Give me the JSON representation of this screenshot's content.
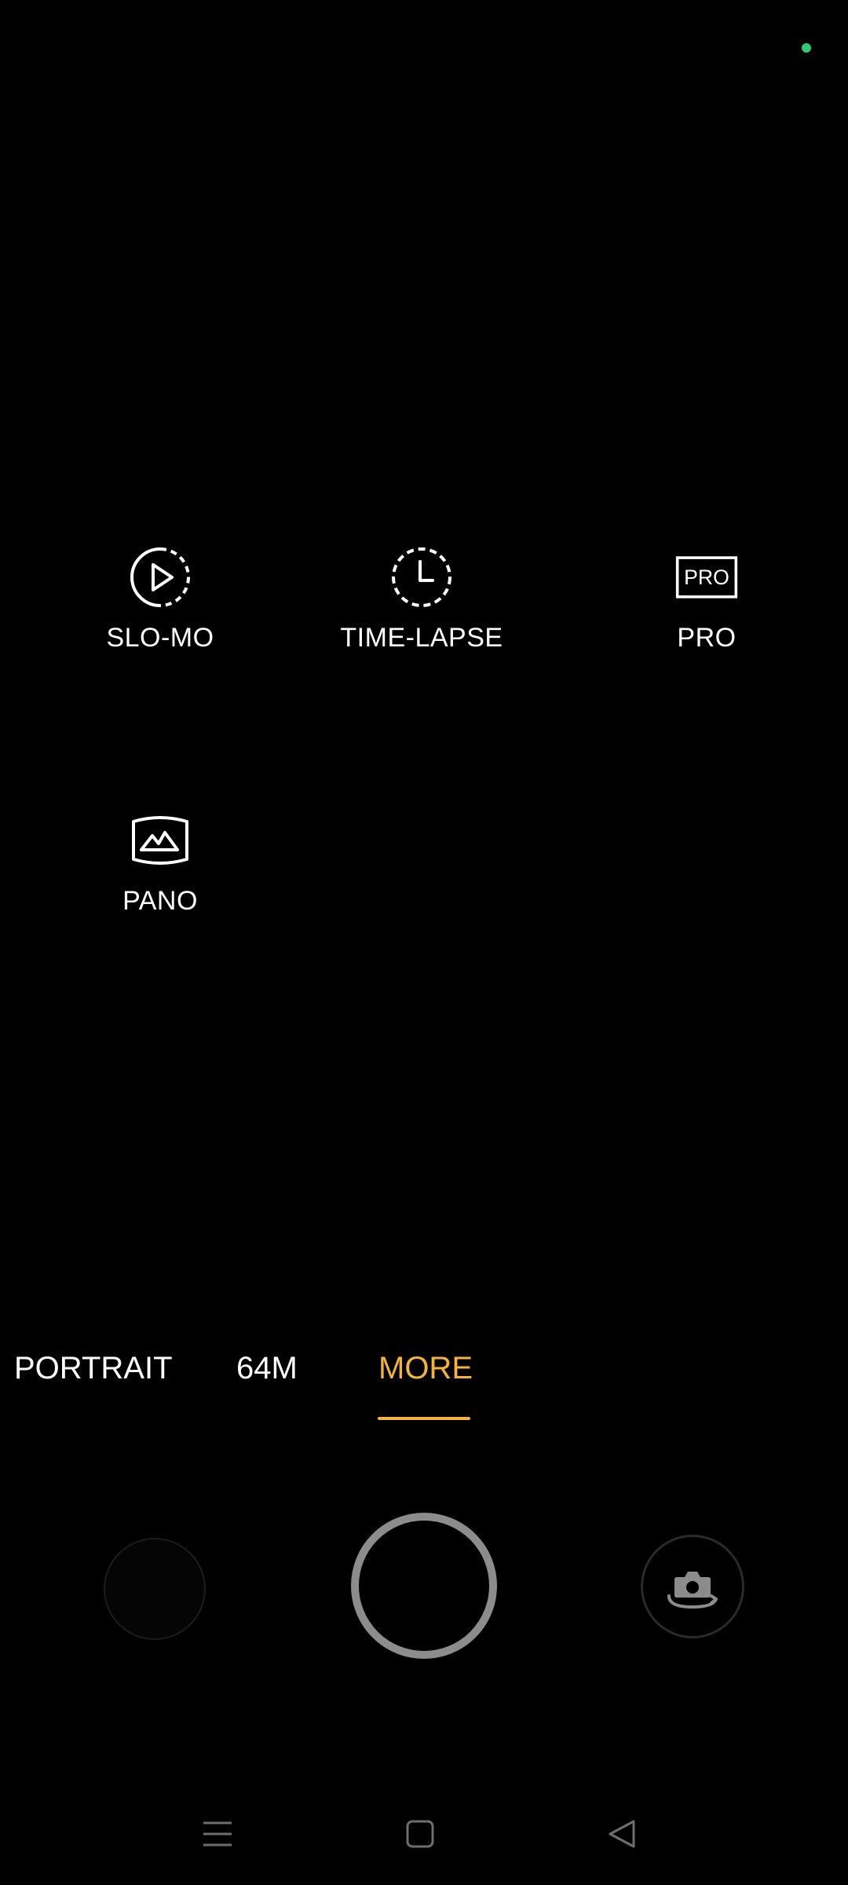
{
  "status": {
    "privacy_indicator_color": "#2ecc71"
  },
  "more_modes": [
    {
      "label": "SLO-MO",
      "icon": "slow-motion-icon"
    },
    {
      "label": "TIME-LAPSE",
      "icon": "time-lapse-icon"
    },
    {
      "label": "PRO",
      "icon": "pro-mode-icon",
      "icon_text": "PRO"
    },
    {
      "label": "PANO",
      "icon": "panorama-icon"
    }
  ],
  "mode_strip": {
    "tabs": [
      {
        "label": "PORTRAIT",
        "active": false
      },
      {
        "label": "64M",
        "active": false
      },
      {
        "label": "MORE",
        "active": true
      }
    ],
    "accent_color": "#f4b43c"
  },
  "controls": {
    "gallery": "gallery-thumbnail",
    "shutter": "shutter-button",
    "flip": "flip-camera-icon"
  },
  "nav": {
    "menu": "menu-icon",
    "home": "home-icon",
    "back": "back-icon"
  }
}
